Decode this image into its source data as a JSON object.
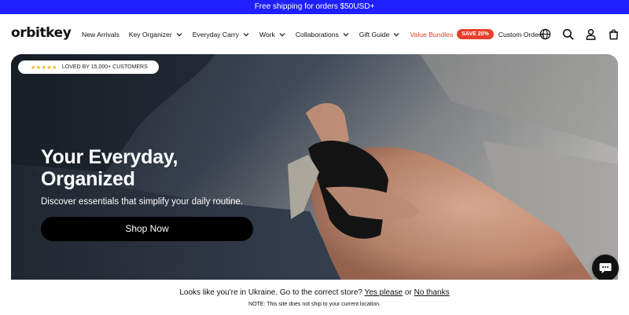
{
  "announcement": {
    "text": "Free shipping for orders $50USD+"
  },
  "header": {
    "logo": "orbitkey",
    "menu": [
      {
        "label": "New Arrivals",
        "has_dropdown": false
      },
      {
        "label": "Key Organizer",
        "has_dropdown": true
      },
      {
        "label": "Everyday Carry",
        "has_dropdown": true
      },
      {
        "label": "Work",
        "has_dropdown": true
      },
      {
        "label": "Collaborations",
        "has_dropdown": true
      },
      {
        "label": "Gift Guide",
        "has_dropdown": true
      },
      {
        "label": "Value Bundles",
        "has_dropdown": false,
        "color": "#e8402c"
      },
      {
        "label": "Custom Orders",
        "has_dropdown": false
      }
    ],
    "sale_badge": "SAVE 20%",
    "icons": [
      "globe-icon",
      "search-icon",
      "account-icon",
      "cart-icon"
    ]
  },
  "hero": {
    "rating_badge": "LOVED BY 15,000+ CUSTOMERS",
    "stars": 5,
    "title_line1": "Your Everyday,",
    "title_line2": "Organized",
    "subtitle": "Discover essentials that simplify your daily routine.",
    "cta": "Shop Now"
  },
  "geo_banner": {
    "prefix": "Looks like you're in Ukraine. Go to the correct store?",
    "yes": "Yes please",
    "or": "or",
    "no": "No thanks",
    "note": "NOTE: This site does not ship to your current location."
  },
  "colors": {
    "accent": "#1f1fff",
    "sale": "#e8402c",
    "star": "#f2b51c"
  }
}
